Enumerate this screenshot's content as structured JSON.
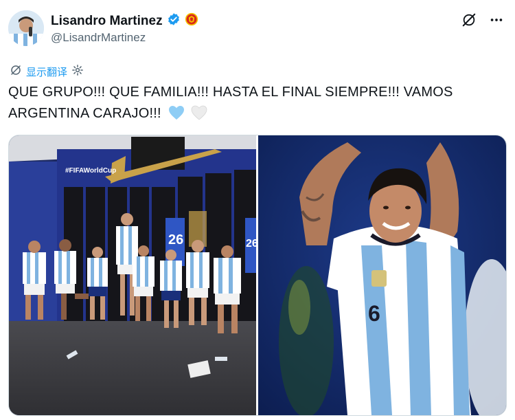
{
  "user": {
    "name": "Lisandro Martinez",
    "handle": "@LisandrMartinez",
    "verified_color": "#1d9bf0",
    "club_badge": "manchester-united-crest"
  },
  "toolbar": {
    "grok_icon": "grok-icon",
    "more_icon": "more-horizontal-icon"
  },
  "translate": {
    "label": "显示翻译",
    "icon": "translate-icon",
    "settings_icon": "gear-icon",
    "color": "#1d9bf0"
  },
  "tweet": {
    "text": "QUE GRUPO!!! QUE FAMILIA!!! HASTA EL FINAL SIEMPRE!!! VAMOS ARGENTINA CARAJO!!!",
    "emojis": [
      "light-blue-heart",
      "white-heart"
    ]
  },
  "media": {
    "left_photo": {
      "description_name": "team-locker-room-photo",
      "signs": [
        "#FIFAWorldCup",
        "26",
        "26"
      ]
    },
    "right_photo": {
      "description_name": "player-celebrating-photo",
      "shirt_number": "6"
    }
  }
}
